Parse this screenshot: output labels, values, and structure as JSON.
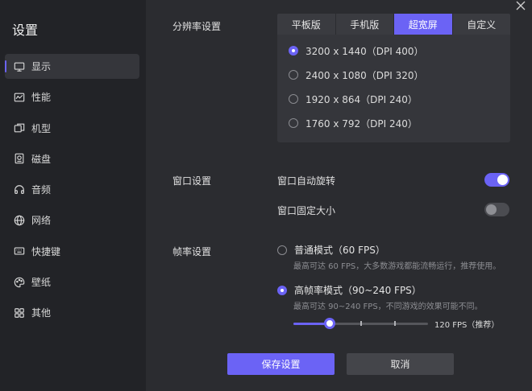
{
  "sidebar": {
    "title": "设置",
    "items": [
      {
        "label": "显示",
        "icon": "monitor-icon"
      },
      {
        "label": "性能",
        "icon": "performance-icon"
      },
      {
        "label": "机型",
        "icon": "device-model-icon"
      },
      {
        "label": "磁盘",
        "icon": "disk-icon"
      },
      {
        "label": "音频",
        "icon": "audio-icon"
      },
      {
        "label": "网络",
        "icon": "globe-icon"
      },
      {
        "label": "快捷键",
        "icon": "keyboard-icon"
      },
      {
        "label": "壁纸",
        "icon": "palette-icon"
      },
      {
        "label": "其他",
        "icon": "grid-icon"
      }
    ],
    "active_index": 0
  },
  "resolution": {
    "label": "分辨率设置",
    "tabs": [
      "平板版",
      "手机版",
      "超宽屏",
      "自定义"
    ],
    "active_tab": 2,
    "options": [
      "3200 x 1440（DPI 400）",
      "2400 x 1080（DPI 320）",
      "1920 x 864（DPI 240）",
      "1760 x 792（DPI 240）"
    ],
    "selected_option": 0
  },
  "window": {
    "label": "窗口设置",
    "auto_rotate_label": "窗口自动旋转",
    "auto_rotate_on": true,
    "fixed_size_label": "窗口固定大小",
    "fixed_size_on": false
  },
  "framerate": {
    "label": "帧率设置",
    "normal_title": "普通模式（60 FPS）",
    "normal_desc": "最高可达 60 FPS，大多数游戏都能流畅运行，推荐使用。",
    "high_title": "高帧率模式（90~240 FPS）",
    "high_desc": "最高可达 90~240 FPS，不同游戏的效果可能不同。",
    "selected": "high",
    "slider_value_label": "120 FPS（推荐）",
    "slider_fraction": 0.27
  },
  "buttons": {
    "save": "保存设置",
    "cancel": "取消"
  },
  "colors": {
    "accent": "#6b63f5",
    "sidebar_bg": "#222327",
    "content_bg": "#2b2c30"
  }
}
